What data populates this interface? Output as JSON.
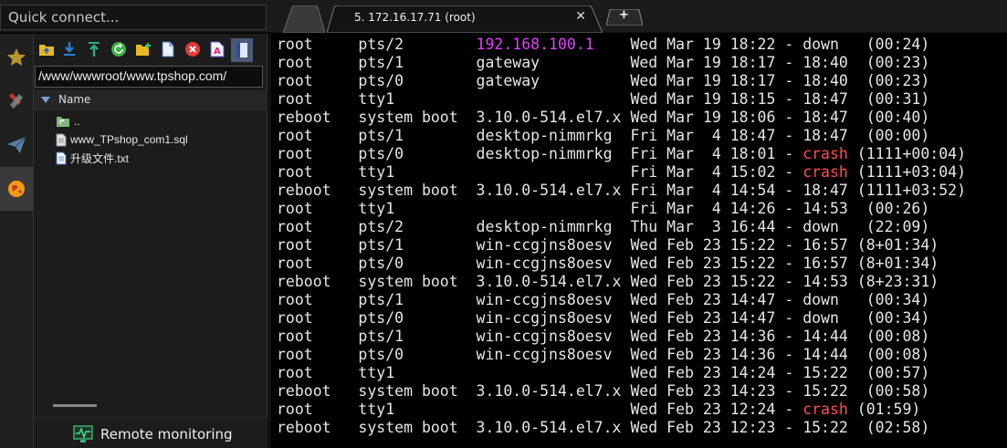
{
  "quick_connect": {
    "placeholder": "Quick connect..."
  },
  "tabs": {
    "home_icon": "home-icon",
    "session": {
      "label": "5. 172.16.17.71 (root)",
      "close": "✕"
    },
    "add": "+"
  },
  "strip": {
    "items": [
      "star-icon",
      "tools-icon",
      "send-icon",
      "globe-icon"
    ]
  },
  "sftp": {
    "toolbar": [
      "folder-up-icon",
      "download-icon",
      "upload-icon",
      "refresh-icon",
      "new-folder-icon",
      "new-file-icon",
      "delete-icon",
      "rename-icon",
      "bookmark-icon"
    ],
    "path": "/www/wwwroot/www.tpshop.com/",
    "column_name": "Name",
    "files": [
      {
        "name": "..",
        "icon": "parent-folder-icon"
      },
      {
        "name": "www_TPshop_com1.sql",
        "icon": "file-icon"
      },
      {
        "name": "升级文件.txt",
        "icon": "text-file-icon"
      }
    ],
    "remote_monitoring": "Remote monitoring"
  },
  "terminal": {
    "colors": {
      "ip": "#e040fb",
      "crash": "#ff4d4d",
      "text": "#e6e6e6"
    },
    "lines": [
      {
        "user": "root",
        "tty": "pts/2",
        "host": "192.168.100.1",
        "host_color": "ip",
        "when": "Wed Mar 19 18:22 - ",
        "end": "down  ",
        "end_color": "",
        "dur": " (00:24)"
      },
      {
        "user": "root",
        "tty": "pts/1",
        "host": "gateway",
        "host_color": "",
        "when": "Wed Mar 19 18:17 - ",
        "end": "18:40 ",
        "end_color": "",
        "dur": " (00:23)"
      },
      {
        "user": "root",
        "tty": "pts/0",
        "host": "gateway",
        "host_color": "",
        "when": "Wed Mar 19 18:17 - ",
        "end": "18:40 ",
        "end_color": "",
        "dur": " (00:23)"
      },
      {
        "user": "root",
        "tty": "tty1",
        "host": "",
        "host_color": "",
        "when": "Wed Mar 19 18:15 - ",
        "end": "18:47 ",
        "end_color": "",
        "dur": " (00:31)"
      },
      {
        "user": "reboot",
        "tty": "system boot",
        "host": "3.10.0-514.el7.x",
        "host_color": "",
        "when": "Wed Mar 19 18:06 - ",
        "end": "18:47 ",
        "end_color": "",
        "dur": " (00:40)"
      },
      {
        "user": "root",
        "tty": "pts/1",
        "host": "desktop-nimmrkg",
        "host_color": "",
        "when": "Fri Mar  4 18:47 - ",
        "end": "18:47 ",
        "end_color": "",
        "dur": " (00:00)"
      },
      {
        "user": "root",
        "tty": "pts/0",
        "host": "desktop-nimmrkg",
        "host_color": "",
        "when": "Fri Mar  4 18:01 - ",
        "end": "crash",
        "end_color": "crash",
        "dur": " (1111+00:04)"
      },
      {
        "user": "root",
        "tty": "tty1",
        "host": "",
        "host_color": "",
        "when": "Fri Mar  4 15:02 - ",
        "end": "crash",
        "end_color": "crash",
        "dur": " (1111+03:04)"
      },
      {
        "user": "reboot",
        "tty": "system boot",
        "host": "3.10.0-514.el7.x",
        "host_color": "",
        "when": "Fri Mar  4 14:54 - ",
        "end": "18:47",
        "end_color": "",
        "dur": " (1111+03:52)"
      },
      {
        "user": "root",
        "tty": "tty1",
        "host": "",
        "host_color": "",
        "when": "Fri Mar  4 14:26 - ",
        "end": "14:53 ",
        "end_color": "",
        "dur": " (00:26)"
      },
      {
        "user": "root",
        "tty": "pts/2",
        "host": "desktop-nimmrkg",
        "host_color": "",
        "when": "Thu Mar  3 16:44 - ",
        "end": "down  ",
        "end_color": "",
        "dur": " (22:09)"
      },
      {
        "user": "root",
        "tty": "pts/1",
        "host": "win-ccgjns8oesv",
        "host_color": "",
        "when": "Wed Feb 23 15:22 - ",
        "end": "16:57",
        "end_color": "",
        "dur": " (8+01:34)"
      },
      {
        "user": "root",
        "tty": "pts/0",
        "host": "win-ccgjns8oesv",
        "host_color": "",
        "when": "Wed Feb 23 15:22 - ",
        "end": "16:57",
        "end_color": "",
        "dur": " (8+01:34)"
      },
      {
        "user": "reboot",
        "tty": "system boot",
        "host": "3.10.0-514.el7.x",
        "host_color": "",
        "when": "Wed Feb 23 15:22 - ",
        "end": "14:53",
        "end_color": "",
        "dur": " (8+23:31)"
      },
      {
        "user": "root",
        "tty": "pts/1",
        "host": "win-ccgjns8oesv",
        "host_color": "",
        "when": "Wed Feb 23 14:47 - ",
        "end": "down  ",
        "end_color": "",
        "dur": " (00:34)"
      },
      {
        "user": "root",
        "tty": "pts/0",
        "host": "win-ccgjns8oesv",
        "host_color": "",
        "when": "Wed Feb 23 14:47 - ",
        "end": "down  ",
        "end_color": "",
        "dur": " (00:34)"
      },
      {
        "user": "root",
        "tty": "pts/1",
        "host": "win-ccgjns8oesv",
        "host_color": "",
        "when": "Wed Feb 23 14:36 - ",
        "end": "14:44 ",
        "end_color": "",
        "dur": " (00:08)"
      },
      {
        "user": "root",
        "tty": "pts/0",
        "host": "win-ccgjns8oesv",
        "host_color": "",
        "when": "Wed Feb 23 14:36 - ",
        "end": "14:44 ",
        "end_color": "",
        "dur": " (00:08)"
      },
      {
        "user": "root",
        "tty": "tty1",
        "host": "",
        "host_color": "",
        "when": "Wed Feb 23 14:24 - ",
        "end": "15:22 ",
        "end_color": "",
        "dur": " (00:57)"
      },
      {
        "user": "reboot",
        "tty": "system boot",
        "host": "3.10.0-514.el7.x",
        "host_color": "",
        "when": "Wed Feb 23 14:23 - ",
        "end": "15:22 ",
        "end_color": "",
        "dur": " (00:58)"
      },
      {
        "user": "root",
        "tty": "tty1",
        "host": "",
        "host_color": "",
        "when": "Wed Feb 23 12:24 - ",
        "end": "crash",
        "end_color": "crash",
        "dur": " (01:59)"
      },
      {
        "user": "reboot",
        "tty": "system boot",
        "host": "3.10.0-514.el7.x",
        "host_color": "",
        "when": "Wed Feb 23 12:23 - ",
        "end": "15:22 ",
        "end_color": "",
        "dur": " (02:58)"
      }
    ]
  }
}
